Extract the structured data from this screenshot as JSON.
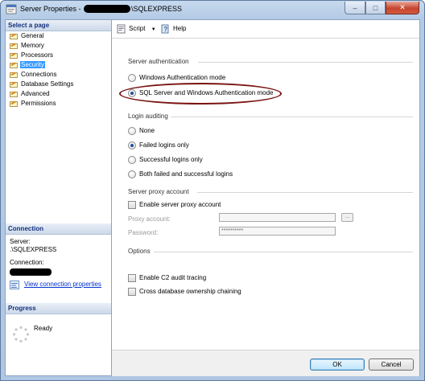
{
  "window": {
    "title_prefix": "Server Properties - ",
    "title_suffix": "\\SQLEXPRESS",
    "buttons": {
      "minimize": "–",
      "maximize": "□",
      "close": "✕"
    }
  },
  "left": {
    "select_page_header": "Select a page",
    "pages": [
      "General",
      "Memory",
      "Processors",
      "Security",
      "Connections",
      "Database Settings",
      "Advanced",
      "Permissions"
    ],
    "selected_page": "Security",
    "connection": {
      "header": "Connection",
      "server_label": "Server:",
      "server_value": ".\\SQLEXPRESS",
      "connection_label": "Connection:",
      "view_link": "View connection properties"
    },
    "progress": {
      "header": "Progress",
      "status": "Ready"
    }
  },
  "toolbar": {
    "script_label": "Script",
    "help_label": "Help"
  },
  "security": {
    "server_auth": {
      "label": "Server authentication",
      "windows_mode": "Windows Authentication mode",
      "mixed_mode": "SQL Server and Windows Authentication mode",
      "selected": "mixed_mode"
    },
    "login_auditing": {
      "label": "Login auditing",
      "none": "None",
      "failed_only": "Failed logins only",
      "successful_only": "Successful logins only",
      "both": "Both failed and successful logins",
      "selected": "failed_only"
    },
    "proxy": {
      "label": "Server proxy account",
      "enable_label": "Enable server proxy account",
      "enabled": false,
      "proxy_account_label": "Proxy account:",
      "proxy_account_value": "",
      "browse_label": "...",
      "password_label": "Password:",
      "password_value": "**********"
    },
    "options": {
      "label": "Options",
      "c2_audit": "Enable C2 audit tracing",
      "cross_db": "Cross database ownership chaining",
      "c2_checked": false,
      "cross_db_checked": false
    }
  },
  "footer": {
    "ok_label": "OK",
    "cancel_label": "Cancel"
  },
  "colors": {
    "selection": "#3399ff",
    "annotation": "#7a1412",
    "link": "#0033cc"
  }
}
